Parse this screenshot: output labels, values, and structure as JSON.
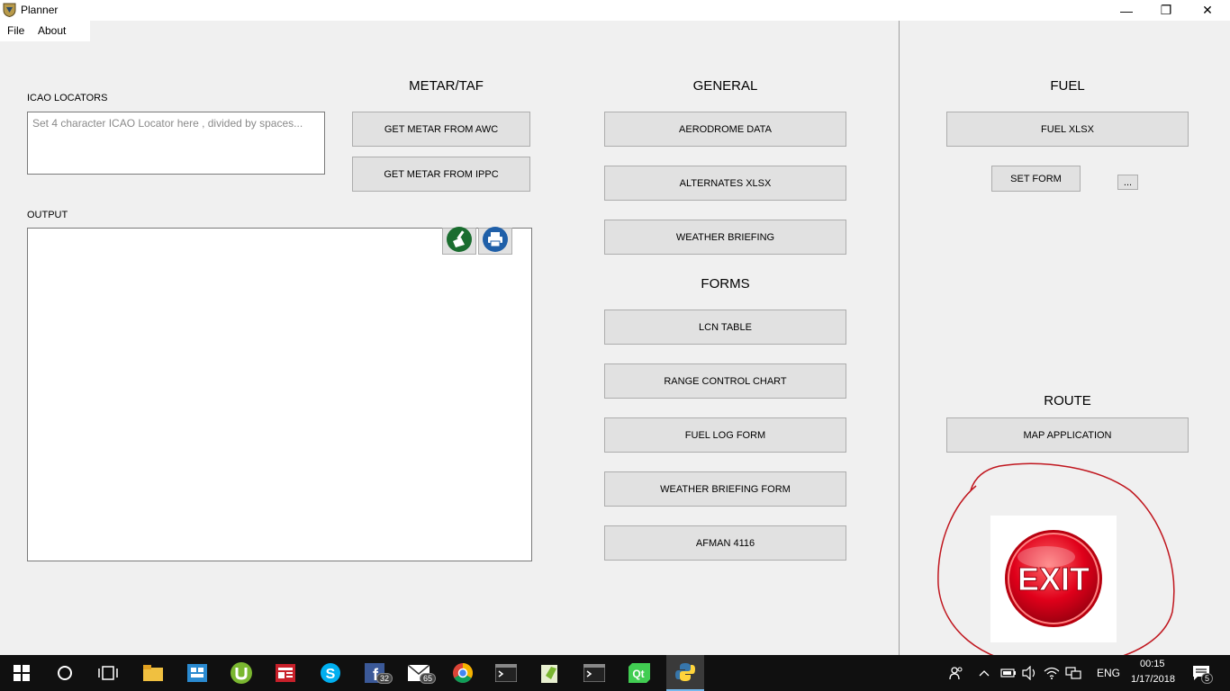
{
  "window": {
    "title": "Planner",
    "minimize": "—",
    "maximize": "❐",
    "close": "✕"
  },
  "menu": {
    "file": "File",
    "about": "About"
  },
  "icao": {
    "label": "ICAO LOCATORS",
    "placeholder": "Set 4 character ICAO Locator here , divided by spaces..."
  },
  "output": {
    "label": "OUTPUT"
  },
  "metar": {
    "heading": "METAR/TAF",
    "awc": "GET METAR FROM AWC",
    "ippc": "GET METAR FROM IPPC"
  },
  "general": {
    "heading": "GENERAL",
    "aerodrome": "AERODROME DATA",
    "alternates": "ALTERNATES XLSX",
    "weather": "WEATHER BRIEFING"
  },
  "forms": {
    "heading": "FORMS",
    "lcn": "LCN TABLE",
    "range": "RANGE CONTROL CHART",
    "fuel_log": "FUEL LOG FORM",
    "weather_form": "WEATHER BRIEFING FORM",
    "afman": "AFMAN 4116"
  },
  "fuel": {
    "heading": "FUEL",
    "xlsx": "FUEL XLSX",
    "set_form": "SET FORM",
    "browse": "..."
  },
  "route": {
    "heading": "ROUTE",
    "map": "MAP APPLICATION"
  },
  "exit": {
    "label": "EXIT"
  },
  "colors": {
    "exit_red": "#e0001a",
    "annotation_red": "#c0161e",
    "clear_green": "#1a6d2f",
    "print_blue": "#1f5fa8"
  },
  "taskbar": {
    "facebook_badge": "32",
    "mail_badge": "65",
    "lang": "ENG",
    "time": "00:15",
    "date": "1/17/2018",
    "notif_count": "5"
  }
}
